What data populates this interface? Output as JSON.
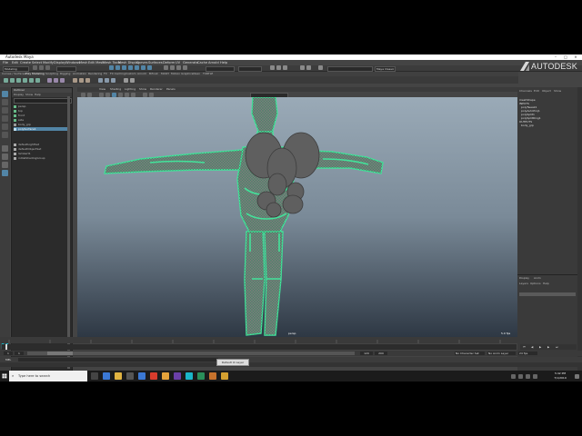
{
  "window": {
    "title": "Autodesk Maya"
  },
  "menu": {
    "items": [
      "File",
      "Edit",
      "Create",
      "Select",
      "Modify",
      "Display",
      "Windows",
      "Mesh",
      "Edit Mesh",
      "Mesh Tools",
      "Mesh Display",
      "Curves",
      "Surfaces",
      "Deform",
      "UV",
      "Generate",
      "Cache",
      "Arnold",
      "Help"
    ]
  },
  "workspace": {
    "mode": "Modeling",
    "label": "Workspace:",
    "name": "Maya Classic"
  },
  "shelf": {
    "tabs": [
      "Curves / Surfaces",
      "Poly Modeling",
      "Sculpting",
      "Rigging",
      "Animation",
      "Rendering",
      "FX",
      "FX Caching",
      "Custom",
      "Arnold",
      "Bifrost",
      "MASH",
      "Motion Graphics",
      "XGen",
      "TURTLE"
    ]
  },
  "brand": {
    "name": "AUTODESK"
  },
  "outliner": {
    "title": "Outliner",
    "menu": [
      "Display",
      "Show",
      "Help"
    ],
    "items": [
      "persp",
      "top",
      "front",
      "side",
      "body_grp",
      "polySurface1",
      "defaultLightSet",
      "defaultObjectSet",
      "lambert1",
      "initialShadingGroup"
    ]
  },
  "viewport": {
    "menu": [
      "View",
      "Shading",
      "Lighting",
      "Show",
      "Renderer",
      "Panels"
    ],
    "camera": "persp",
    "fps": "5.0 fps"
  },
  "channelbox": {
    "tabs": [
      "Channels",
      "Edit",
      "Object",
      "Show"
    ],
    "items": [
      "meshShape",
      "INPUTS",
      "polyTweak1",
      "polyAutoProj1",
      "polySplit1",
      "polySplitRing1",
      "OUTPUTS",
      "body_grp"
    ]
  },
  "layers": {
    "tabs": [
      "Display",
      "Anim"
    ],
    "menu": [
      "Layers",
      "Options",
      "Help"
    ]
  },
  "timeline": {
    "start": "1",
    "end": "120",
    "rangeEnd": "200",
    "character": "No Character Set",
    "animLayer": "No Anim Layer",
    "fps": "24 fps"
  },
  "mel": {
    "label": "MEL"
  },
  "tooltip": {
    "text": "Default Ui Layer"
  },
  "taskbar": {
    "search": "Type here to search",
    "time": "5:42 PM",
    "date": "7/1/2019"
  },
  "colors": {
    "wireframe": "#43e39b",
    "viewportTop": "#9aaab7",
    "viewportBottom": "#2e3844",
    "selection": "#5285a6"
  }
}
